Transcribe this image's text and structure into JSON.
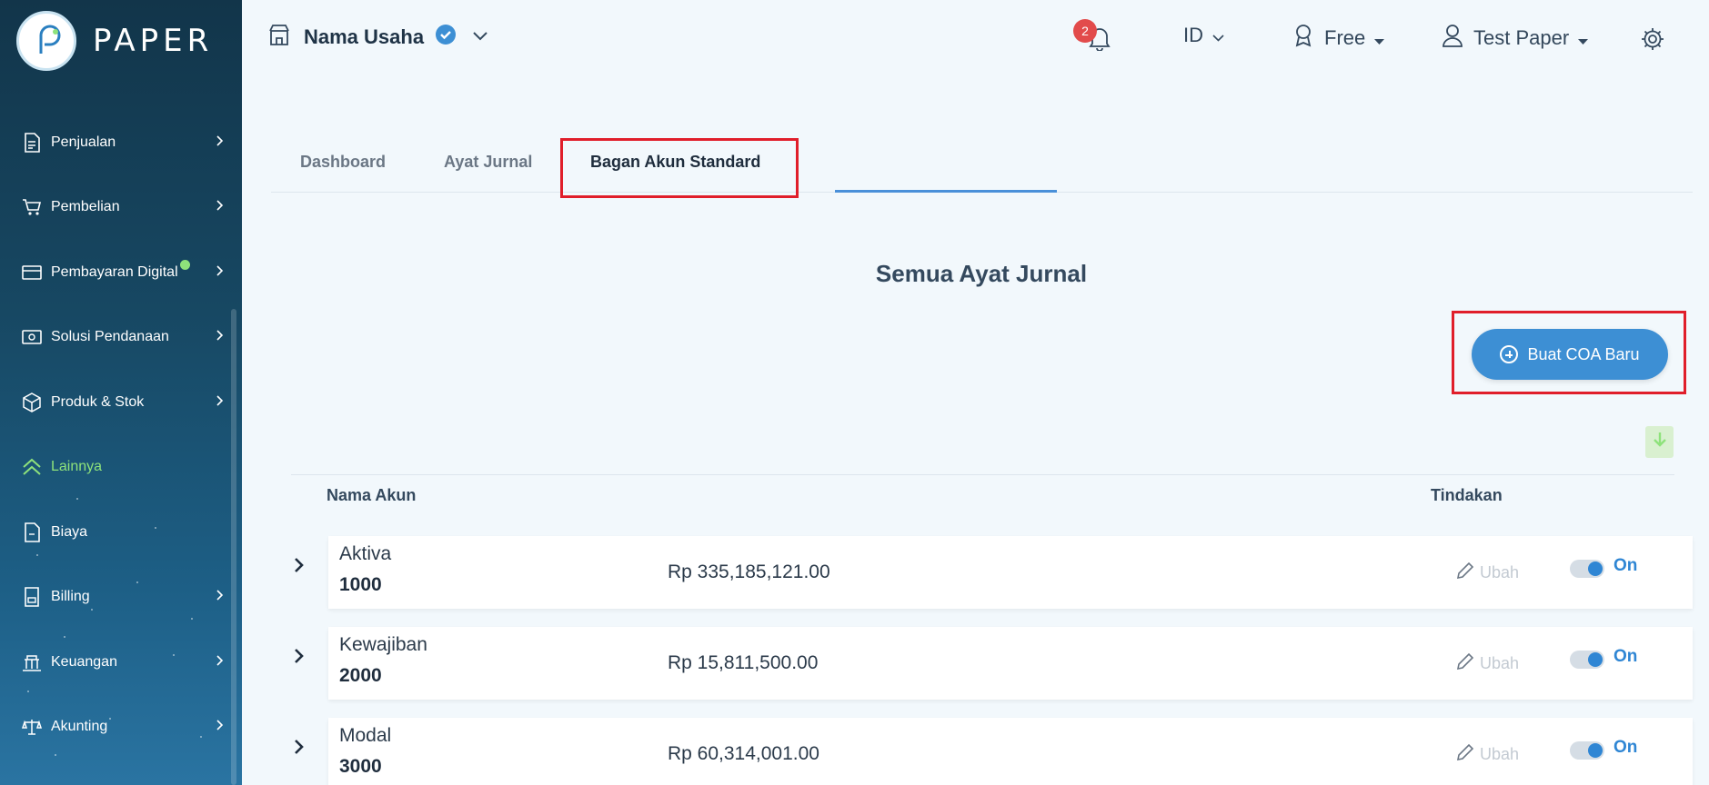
{
  "brand": {
    "name": "PAPER"
  },
  "header": {
    "business_name": "Nama Usaha",
    "notification_count": "2",
    "language": "ID",
    "plan": "Free",
    "user": "Test Paper"
  },
  "sidebar": {
    "items": [
      {
        "label": "Penjualan",
        "icon": "document-icon"
      },
      {
        "label": "Pembelian",
        "icon": "cart-icon"
      },
      {
        "label": "Pembayaran Digital",
        "icon": "card-icon"
      },
      {
        "label": "Solusi Pendanaan",
        "icon": "money-icon"
      },
      {
        "label": "Produk & Stok",
        "icon": "box-icon"
      },
      {
        "label": "Lainnya",
        "icon": "chevrons-up-icon"
      },
      {
        "label": "Biaya",
        "icon": "receipt-icon"
      },
      {
        "label": "Billing",
        "icon": "billing-icon"
      },
      {
        "label": "Keuangan",
        "icon": "bank-icon"
      },
      {
        "label": "Akunting",
        "icon": "scale-icon"
      }
    ]
  },
  "tabs": [
    {
      "label": "Dashboard"
    },
    {
      "label": "Ayat Jurnal"
    },
    {
      "label": "Bagan Akun Standard"
    }
  ],
  "main": {
    "title": "Semua Ayat Jurnal",
    "new_button": "Buat COA Baru",
    "columns": {
      "name": "Nama Akun",
      "actions": "Tindakan"
    },
    "rows": [
      {
        "name": "Aktiva",
        "code": "1000",
        "amount": "Rp 335,185,121.00",
        "edit": "Ubah",
        "status": "On"
      },
      {
        "name": "Kewajiban",
        "code": "2000",
        "amount": "Rp 15,811,500.00",
        "edit": "Ubah",
        "status": "On"
      },
      {
        "name": "Modal",
        "code": "3000",
        "amount": "Rp 60,314,001.00",
        "edit": "Ubah",
        "status": "On"
      }
    ]
  },
  "colors": {
    "accent": "#3d8fd4",
    "active_nav": "#8ee27b",
    "highlight": "#e01e2a",
    "badge": "#e24b4b"
  }
}
